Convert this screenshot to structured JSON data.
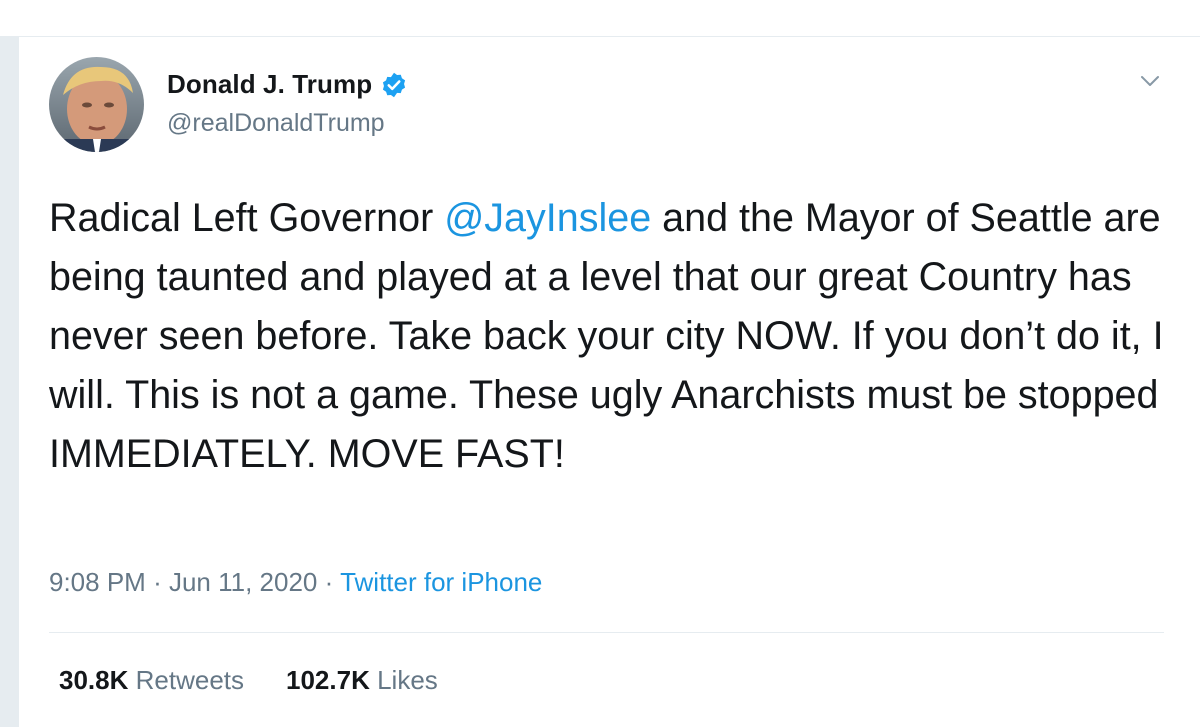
{
  "tweet": {
    "author": {
      "display_name": "Donald J. Trump",
      "handle": "@realDonaldTrump",
      "verified": true
    },
    "text_parts": {
      "before_mention": "Radical Left Governor ",
      "mention": "@JayInslee",
      "after_mention": " and the Mayor of Seattle are being taunted and played at a level that our great Country has never seen before. Take back your city NOW. If you don’t do it, I will. This is not a game. These ugly Anarchists must be stopped IMMEDIATELY. MOVE FAST!"
    },
    "time": "9:08 PM",
    "date": "Jun 11, 2020",
    "separator": "·",
    "source": "Twitter for iPhone",
    "stats": {
      "retweets_count": "30.8K",
      "retweets_label": "Retweets",
      "likes_count": "102.7K",
      "likes_label": "Likes"
    }
  },
  "icons": {
    "verified": "verified-badge-icon",
    "menu": "chevron-down-icon"
  },
  "colors": {
    "link": "#1b95e0",
    "text": "#14171a",
    "muted": "#657786",
    "background": "#e6ecf0"
  }
}
